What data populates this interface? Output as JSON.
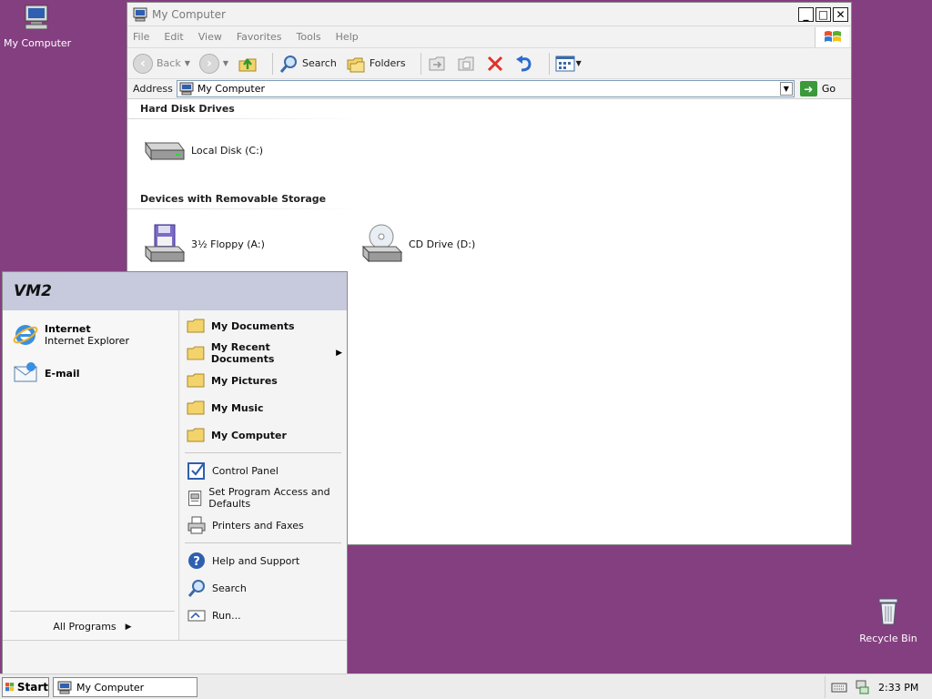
{
  "desktop": {
    "icons": [
      {
        "label": "My Computer"
      },
      {
        "label": "Recycle Bin"
      }
    ]
  },
  "window": {
    "title": "My Computer",
    "controls": {
      "minimize": "_",
      "maximize": "□",
      "close": "✕"
    },
    "menu": [
      "File",
      "Edit",
      "View",
      "Favorites",
      "Tools",
      "Help"
    ],
    "toolbar": {
      "back": "Back",
      "search": "Search",
      "folders": "Folders"
    },
    "address": {
      "label": "Address",
      "value": "My Computer",
      "go": "Go"
    },
    "groups": [
      {
        "title": "Hard Disk Drives",
        "items": [
          {
            "label": "Local Disk (C:)",
            "icon": "hard-disk-icon"
          }
        ]
      },
      {
        "title": "Devices with Removable Storage",
        "items": [
          {
            "label": "3½ Floppy (A:)",
            "icon": "floppy-drive-icon"
          },
          {
            "label": "CD Drive (D:)",
            "icon": "cd-drive-icon"
          }
        ]
      }
    ]
  },
  "start_menu": {
    "user": "VM2",
    "pinned": [
      {
        "title": "Internet",
        "subtitle": "Internet Explorer",
        "icon": "internet-explorer-icon"
      },
      {
        "title": "E-mail",
        "subtitle": "",
        "icon": "email-icon"
      }
    ],
    "all_programs": "All Programs",
    "places": [
      {
        "label": "My Documents"
      },
      {
        "label": "My Recent Documents"
      },
      {
        "label": "My Pictures"
      },
      {
        "label": "My Music"
      },
      {
        "label": "My Computer"
      }
    ],
    "settings": [
      {
        "label": "Control Panel"
      },
      {
        "label": "Set Program Access and Defaults"
      },
      {
        "label": "Printers and Faxes"
      }
    ],
    "help": [
      {
        "label": "Help and Support"
      },
      {
        "label": "Search"
      },
      {
        "label": "Run..."
      }
    ]
  },
  "taskbar": {
    "start": "Start",
    "task": "My Computer",
    "clock": "2:33 PM"
  },
  "colors": {
    "desktop": "#843f80",
    "start_header": "#c7c9dd",
    "address_border": "#7f9db9"
  }
}
